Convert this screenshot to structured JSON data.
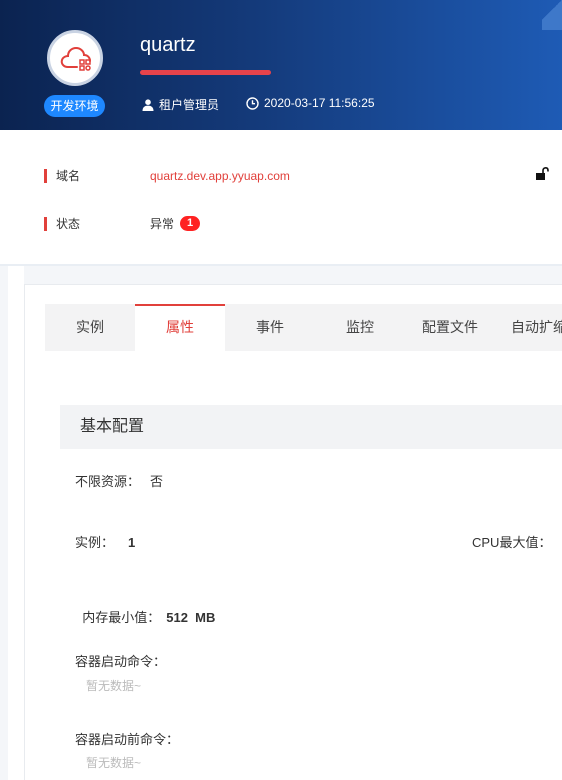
{
  "header": {
    "app_name": "quartz",
    "env_badge": "开发环境",
    "user_role": "租户管理员",
    "timestamp": "2020-03-17 11:56:25"
  },
  "info": {
    "domain_label": "域名",
    "domain_value": "quartz.dev.app.yyuap.com",
    "status_label": "状态",
    "status_value": "异常",
    "status_count": "1"
  },
  "tabs": [
    {
      "label": "实例",
      "active": false
    },
    {
      "label": "属性",
      "active": true
    },
    {
      "label": "事件",
      "active": false
    },
    {
      "label": "监控",
      "active": false
    },
    {
      "label": "配置文件",
      "active": false
    },
    {
      "label": "自动扩缩",
      "active": false
    }
  ],
  "config": {
    "section_title": "基本配置",
    "unlimited_label": "不限资源：",
    "unlimited_value": "否",
    "instances_label": "实例：",
    "instances_value": "1",
    "cpu_max_label": "CPU最大值：",
    "mem_min_label": "内存最小值：",
    "mem_min_value": "512  MB",
    "start_cmd_label": "容器启动命令：",
    "start_cmd_value": "暂无数据~",
    "prestart_cmd_label": "容器启动前命令：",
    "prestart_cmd_value": "暂无数据~"
  },
  "colors": {
    "accent": "#e1403b",
    "badge_blue": "#1e88ff",
    "header_dark": "#0b2350",
    "header_light": "#1e5bb5"
  },
  "icons": [
    "cloud-app-icon",
    "user-icon",
    "clock-icon",
    "unlock-icon"
  ]
}
